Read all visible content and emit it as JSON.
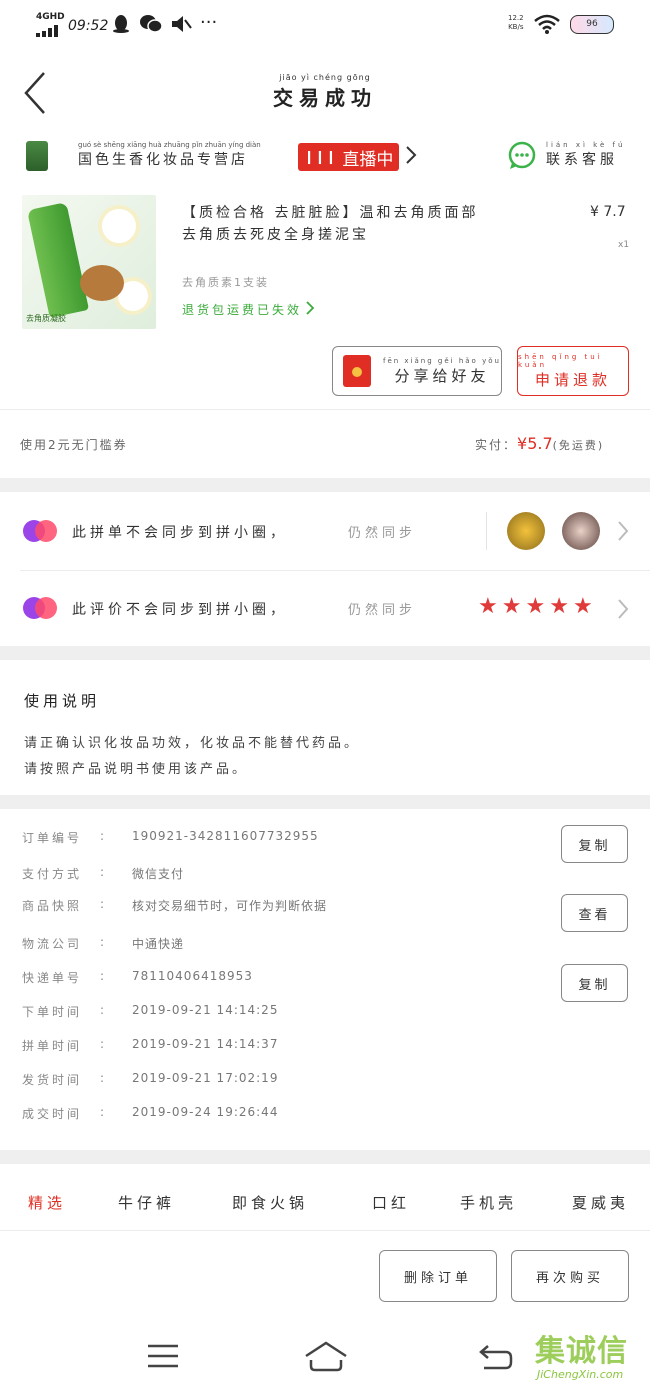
{
  "status_bar": {
    "network": "4GHD",
    "time": "09:52",
    "speed_top": "12.2",
    "speed_unit": "KB/s",
    "battery": "96",
    "more": "···"
  },
  "header": {
    "title": "交易成功",
    "title_py": "jiāo yì chéng gōng"
  },
  "store": {
    "name": "国色生香化妆品专营店",
    "name_py": "guó sè shēng xiāng huà zhuāng pǐn zhuān yíng diàn",
    "live_label": "直播中",
    "contact": "联系客服",
    "contact_py": "lián xì kè fú"
  },
  "product": {
    "title_line1": "【质检合格 去脏脏脸】温和去角质面部",
    "title_line2": "去角质去死皮全身搓泥宝",
    "spec": "去角质素1支装",
    "notice": "退货包运费已失效",
    "price": "¥ 7.7",
    "qty": "x1",
    "image_text": "去角质凝胶"
  },
  "actions_top": {
    "share": "分享给好友",
    "share_py": "fēn xiǎng gěi hǎo yǒu",
    "refund": "申请退款",
    "refund_py": "shēn qǐng tuì kuǎn"
  },
  "coupon": {
    "text": "使用2元无门槛券",
    "paid_label": "实付：",
    "paid_amount": "¥5.7",
    "paid_note": "(免运费)"
  },
  "sync": {
    "order_text": "此拼单不会同步到拼小圈，",
    "order_status": "仍然同步",
    "review_text": "此评价不会同步到拼小圈，",
    "review_status": "仍然同步",
    "rating": 5
  },
  "usage": {
    "title": "使用说明",
    "line1": "请正确认识化妆品功效，化妆品不能替代药品。",
    "line2": "请按照产品说明书使用该产品。"
  },
  "order_info": {
    "rows": [
      {
        "label": "订单编号",
        "value": "190921-342811607732955",
        "button": "复制"
      },
      {
        "label": "支付方式",
        "value": "微信支付",
        "button": ""
      },
      {
        "label": "商品快照",
        "value": "核对交易细节时，可作为判断依据",
        "button": "查看"
      },
      {
        "label": "物流公司",
        "value": "中通快递",
        "button": ""
      },
      {
        "label": "快递单号",
        "value": "78110406418953",
        "button": "复制"
      },
      {
        "label": "下单时间",
        "value": "2019-09-21 14:14:25",
        "button": ""
      },
      {
        "label": "拼单时间",
        "value": "2019-09-21 14:14:37",
        "button": ""
      },
      {
        "label": "发货时间",
        "value": "2019-09-21 17:02:19",
        "button": ""
      },
      {
        "label": "成交时间",
        "value": "2019-09-24 19:26:44",
        "button": ""
      }
    ]
  },
  "recommend_tabs": [
    "精选",
    "牛仔裤",
    "即食火锅",
    "口红",
    "手机壳",
    "夏威夷"
  ],
  "bottom_actions": {
    "delete": "删除订单",
    "rebuy": "再次购买"
  },
  "watermark": {
    "brand": "集诚信",
    "url": "JiChengXin.com"
  },
  "colors": {
    "accent": "#e02e24",
    "green": "#3aab3a",
    "wechat": "#3cb34a"
  }
}
